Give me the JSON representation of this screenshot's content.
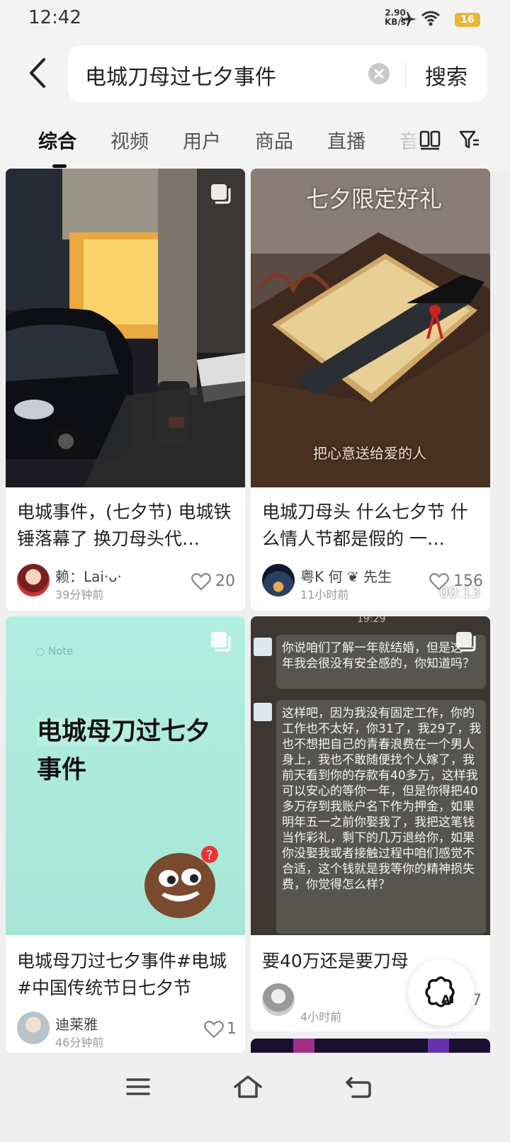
{
  "status": {
    "time": "12:42",
    "speed": "2.90",
    "speed_unit": "KB/s",
    "battery": "16"
  },
  "search": {
    "query": "电城刀母过七夕事件",
    "button": "搜索"
  },
  "tabs": [
    {
      "label": "综合",
      "active": true
    },
    {
      "label": "视频"
    },
    {
      "label": "用户"
    },
    {
      "label": "商品"
    },
    {
      "label": "直播"
    },
    {
      "label": "音"
    }
  ],
  "cards": [
    {
      "title": "电城事件，(七夕节) 电城铁锤落幕了 换刀母头代…",
      "author": "赖：Lai·ᴗ·",
      "time": "39分钟前",
      "likes": "20"
    },
    {
      "title": "电城刀母头 什么七夕节 什么情人节都是假的 一…",
      "author": "粤K 何 ❦ 先生",
      "time": "11小时前",
      "likes": "156",
      "cover_text": "七夕限定好礼",
      "cover_subtext": "把心意送给爱的人",
      "duration": "00:13"
    },
    {
      "title": "电城母刀过七夕事件#电城 #中国传统节日七夕节",
      "author": "迪莱雅",
      "time": "46分钟前",
      "likes": "1",
      "note_tag": "Note",
      "note_highlight": "电城母刀",
      "note_rest": "过七夕事件"
    },
    {
      "title": "要40万还是要刀母",
      "author": "",
      "time": "4小时前",
      "likes": "7",
      "chat_time": "19:29",
      "chat_1": "你说咱们了解一年就结婚，但是这一年我会很没有安全感的，你知道吗？",
      "chat_2": "这样吧，因为我没有固定工作，你的工作也不太好，你31了，我29了，我也不想把自己的青春浪费在一个男人身上，我也不敢随便找个人嫁了，我前天看到你的存款有40多万，这样我可以安心的等你一年，但是你得把40多万存到我账户名下作为押金，如果明年五一之前你娶我了，我把这笔钱当作彩礼，剩下的几万退给你，如果你没娶我或者接触过程中咱们感觉不合适，这个钱就是我等你的精神损失费，你觉得怎么样？"
    }
  ],
  "ai_label": "AI"
}
